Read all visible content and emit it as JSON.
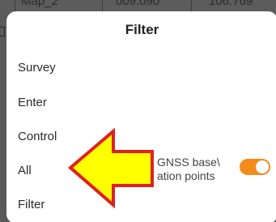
{
  "background_row": {
    "col1": "Map_2",
    "col2": "009.090",
    "col3": "106.769"
  },
  "dialog": {
    "title": "Filter",
    "options": [
      {
        "label": "Survey"
      },
      {
        "label": "Enter"
      },
      {
        "label": "Control"
      },
      {
        "label": "All"
      },
      {
        "label": "Filter"
      }
    ],
    "toggle": {
      "label_line1": "GNSS base\\",
      "label_line2": "ation points",
      "state": "on",
      "color": "#f28c1c"
    }
  },
  "annotation": {
    "shape": "arrow-left",
    "fill": "#ffff00",
    "stroke": "#e02020"
  }
}
